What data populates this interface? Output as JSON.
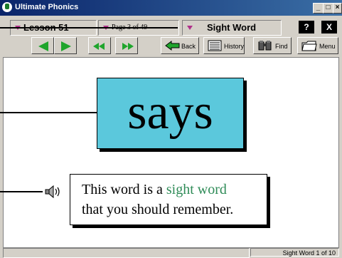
{
  "window": {
    "title": "Ultimate Phonics"
  },
  "title_buttons": {
    "minimize": "_",
    "maximize": "□",
    "close": "×"
  },
  "selectors": {
    "lesson": "Lesson 51",
    "page": "Page 3  of  49",
    "section": "Sight Word"
  },
  "top_buttons": {
    "help": "?",
    "close": "X"
  },
  "toolbar": {
    "back": "Back",
    "history": "History",
    "find": "Find",
    "menu": "Menu"
  },
  "content": {
    "word": "says",
    "note_prefix": "This word is a ",
    "note_highlight": "sight word",
    "note_line2": "that you should remember."
  },
  "status": {
    "right": "Sight Word  1 of 10"
  },
  "colors": {
    "accent_green": "#1fa52c",
    "card_blue": "#5bc8dc",
    "highlight_text": "#2e8b57",
    "selector_arrow": "#b0308a"
  }
}
